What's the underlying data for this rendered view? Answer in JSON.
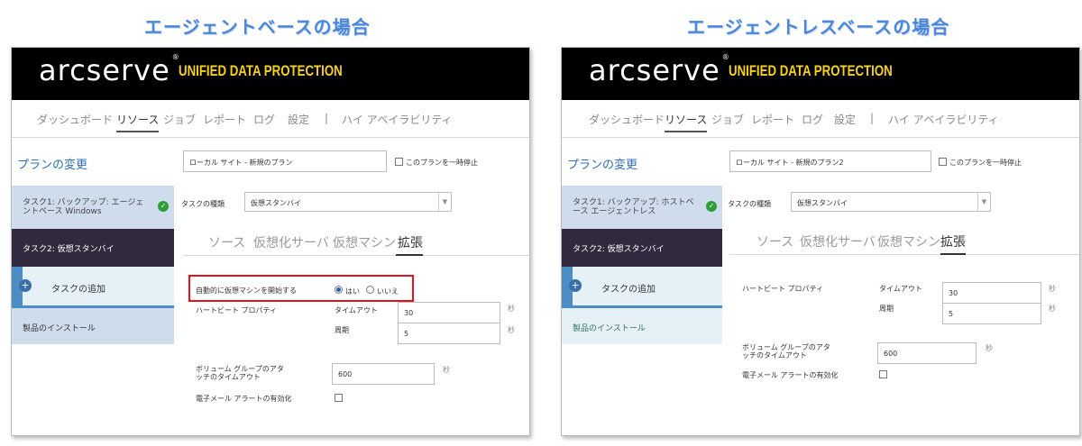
{
  "left": {
    "heading": "エージェントベースの場合",
    "logo": "arcserve",
    "logo_mark": "®",
    "product": "UNIFIED DATA PROTECTION",
    "nav": [
      "ダッシュボード",
      "リソース",
      "ジョブ",
      "レポート",
      "ログ",
      "設定",
      "|",
      "ハイ アベイラビリティ"
    ],
    "sidebar": {
      "title": "プランの変更",
      "task1": "タスク1: バックアップ: エージェントベース Windows",
      "task2": "タスク2: 仮想スタンバイ",
      "add_task": "タスクの追加",
      "install": "製品のインストール"
    },
    "plan_name": "ローカル サイト - 新規のプラン",
    "pause_label": "このプランを一時停止",
    "task_type_label": "タスクの種類",
    "task_type_value": "仮想スタンバイ",
    "subtabs": [
      "ソース",
      "仮想化サーバ",
      "仮想マシン",
      "拡張"
    ],
    "auto_start_label": "自動的に仮想マシンを開始する",
    "radio_yes": "はい",
    "radio_no": "いいえ",
    "heartbeat_label": "ハートビート プロパティ",
    "timeout_label": "タイムアウト",
    "timeout_value": "30",
    "interval_label": "周期",
    "interval_value": "5",
    "unit_seconds": "秒",
    "volume_label": "ボリューム グループのアタッチのタイムアウト",
    "volume_value": "600",
    "email_label": "電子メール アラートの有効化"
  },
  "right": {
    "heading": "エージェントレスベースの場合",
    "logo": "arcserve",
    "logo_mark": "®",
    "product": "UNIFIED DATA PROTECTION",
    "nav": [
      "ダッシュボード",
      "リソース",
      "ジョブ",
      "レポート",
      "ログ",
      "設定",
      "|",
      "ハイ アベイラビリティ"
    ],
    "sidebar": {
      "title": "プランの変更",
      "task1": "タスク1: バックアップ: ホストベース エージェントレス",
      "task2": "タスク2: 仮想スタンバイ",
      "add_task": "タスクの追加",
      "install": "製品のインストール"
    },
    "plan_name": "ローカル サイト - 新規のプラン2",
    "pause_label": "このプランを一時停止",
    "task_type_label": "タスクの種類",
    "task_type_value": "仮想スタンバイ",
    "subtabs": [
      "ソース",
      "仮想化サーバ",
      "仮想マシン",
      "拡張"
    ],
    "heartbeat_label": "ハートビート プロパティ",
    "timeout_label": "タイムアウト",
    "timeout_value": "30",
    "interval_label": "周期",
    "interval_value": "5",
    "unit_seconds": "秒",
    "volume_label": "ボリューム グループのアタッチのタイムアウト",
    "volume_value": "600",
    "email_label": "電子メール アラートの有効化"
  },
  "colors": {
    "heading": "#4a86d9",
    "brand_bar": "#000000",
    "product_text": "#f7d21a",
    "task_selected": "#33293f",
    "task_bg": "#cfdcec",
    "highlight_box": "#e0151c",
    "success_check": "#2f9e3a"
  },
  "icons": [
    "check-circle-icon",
    "plus-circle-icon",
    "chevron-down-icon",
    "radio-selected-icon"
  ]
}
